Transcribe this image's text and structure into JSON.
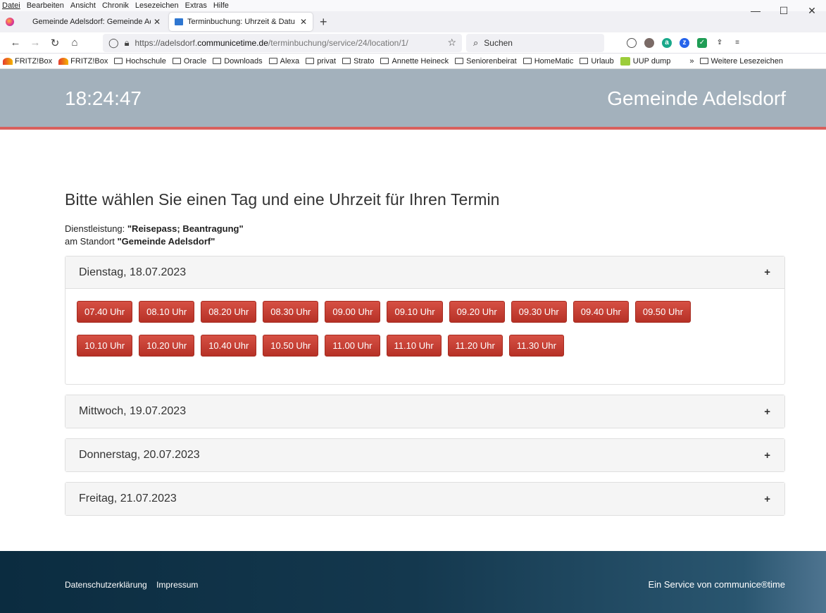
{
  "menubar": {
    "items": [
      "Datei",
      "Bearbeiten",
      "Ansicht",
      "Chronik",
      "Lesezeichen",
      "Extras",
      "Hilfe"
    ]
  },
  "window": {
    "minimize": "—",
    "maximize": "☐",
    "close": "✕"
  },
  "tabs": [
    {
      "title": "Gemeinde Adelsdorf: Gemeinde Ad",
      "close": "✕"
    },
    {
      "title": "Terminbuchung: Uhrzeit & Datu",
      "close": "✕"
    }
  ],
  "nav": {
    "url_prefix": "https://adelsdorf.",
    "url_domain": "communicetime.de",
    "url_path": "/terminbuchung/service/24/location/1/",
    "search_placeholder": "Suchen"
  },
  "bookmarks": [
    {
      "label": "FRITZ!Box",
      "icon": "fritz-icon"
    },
    {
      "label": "FRITZ!Box",
      "icon": "fritz-icon"
    },
    {
      "label": "Hochschule",
      "icon": "folder-icon"
    },
    {
      "label": "Oracle",
      "icon": "folder-icon"
    },
    {
      "label": "Downloads",
      "icon": "folder-icon"
    },
    {
      "label": "Alexa",
      "icon": "folder-icon"
    },
    {
      "label": "privat",
      "icon": "folder-icon"
    },
    {
      "label": "Strato",
      "icon": "folder-icon"
    },
    {
      "label": "Annette Heineck",
      "icon": "folder-icon"
    },
    {
      "label": "Seniorenbeirat",
      "icon": "folder-icon"
    },
    {
      "label": "HomeMatic",
      "icon": "folder-icon"
    },
    {
      "label": "Urlaub",
      "icon": "folder-icon"
    },
    {
      "label": "UUP dump",
      "icon": "uup-icon"
    }
  ],
  "bookmarks_more": "Weitere Lesezeichen",
  "header": {
    "clock": "18:24:47",
    "org": "Gemeinde Adelsdorf"
  },
  "main": {
    "title": "Bitte wählen Sie einen Tag und eine Uhrzeit für Ihren Termin",
    "service_label": "Dienstleistung: ",
    "service_value": "\"Reisepass; Beantragung\"",
    "location_label": "am Standort ",
    "location_value": "\"Gemeinde Adelsdorf\"",
    "days": [
      {
        "label": "Dienstag, 18.07.2023",
        "open": true,
        "slots": [
          "07.40 Uhr",
          "08.10 Uhr",
          "08.20 Uhr",
          "08.30 Uhr",
          "09.00 Uhr",
          "09.10 Uhr",
          "09.20 Uhr",
          "09.30 Uhr",
          "09.40 Uhr",
          "09.50 Uhr",
          "10.10 Uhr",
          "10.20 Uhr",
          "10.40 Uhr",
          "10.50 Uhr",
          "11.00 Uhr",
          "11.10 Uhr",
          "11.20 Uhr",
          "11.30 Uhr"
        ]
      },
      {
        "label": "Mittwoch, 19.07.2023",
        "open": false,
        "slots": []
      },
      {
        "label": "Donnerstag, 20.07.2023",
        "open": false,
        "slots": []
      },
      {
        "label": "Freitag, 21.07.2023",
        "open": false,
        "slots": []
      }
    ],
    "expand_symbol": "+"
  },
  "footer": {
    "privacy": "Datenschutzerklärung",
    "imprint": "Impressum",
    "credit": "Ein Service von communice®time"
  }
}
